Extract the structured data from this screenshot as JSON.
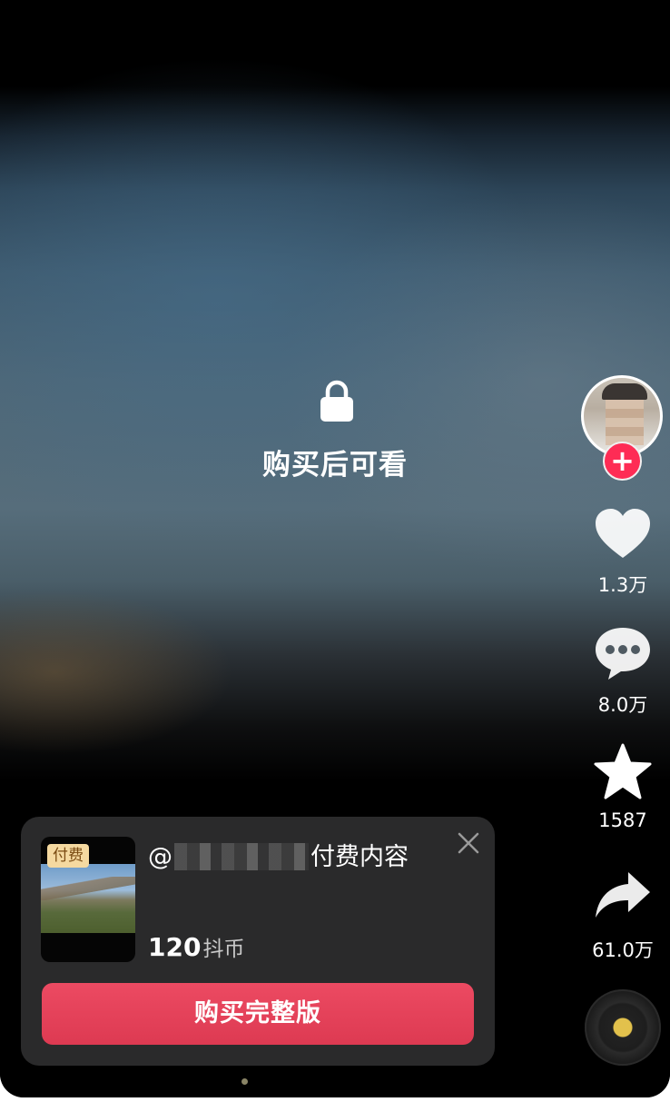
{
  "lock_overlay": {
    "text": "购买后可看",
    "icon": "lock-icon"
  },
  "right_rail": {
    "like_count": "1.3万",
    "comment_count": "8.0万",
    "favorite_count": "1587",
    "share_count": "61.0万",
    "icons": [
      "heart-icon",
      "comment-icon",
      "star-icon",
      "share-icon",
      "music-disc-icon"
    ],
    "accent_color": "#fe2c55"
  },
  "pay_card": {
    "tag": "付费",
    "title_prefix": "@",
    "title_suffix": "付费内容",
    "price": "120",
    "price_unit": "抖币",
    "buy_label": "购买完整版",
    "button_color": "#e54259"
  }
}
